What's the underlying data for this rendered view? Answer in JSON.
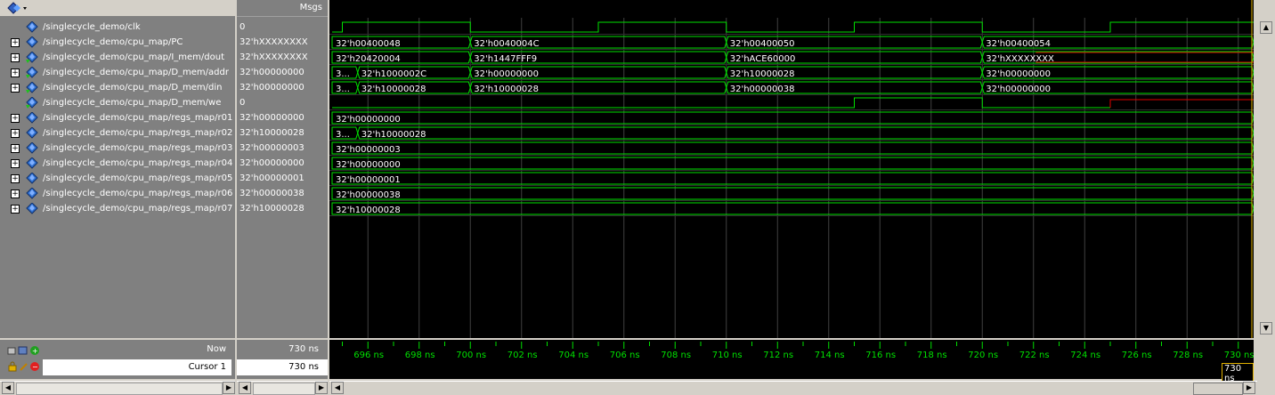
{
  "header": {
    "msgs_label": "Msgs"
  },
  "signals": [
    {
      "name": "/singlecycle_demo/clk",
      "value": "0",
      "expandable": false,
      "icon": "diamond-signal-icon"
    },
    {
      "name": "/singlecycle_demo/cpu_map/PC",
      "value": "32'hXXXXXXXX",
      "expandable": true,
      "icon": "diamond-signal-icon"
    },
    {
      "name": "/singlecycle_demo/cpu_map/I_mem/dout",
      "value": "32'hXXXXXXXX",
      "expandable": true,
      "icon": "diamond-arrow-signal-icon"
    },
    {
      "name": "/singlecycle_demo/cpu_map/D_mem/addr",
      "value": "32'h00000000",
      "expandable": true,
      "icon": "diamond-arrow-signal-icon"
    },
    {
      "name": "/singlecycle_demo/cpu_map/D_mem/din",
      "value": "32'h00000000",
      "expandable": true,
      "icon": "diamond-arrow-signal-icon"
    },
    {
      "name": "/singlecycle_demo/cpu_map/D_mem/we",
      "value": "0",
      "expandable": false,
      "icon": "diamond-arrow-signal-icon"
    },
    {
      "name": "/singlecycle_demo/cpu_map/regs_map/r01",
      "value": "32'h00000000",
      "expandable": true,
      "icon": "diamond-signal-icon"
    },
    {
      "name": "/singlecycle_demo/cpu_map/regs_map/r02",
      "value": "32'h10000028",
      "expandable": true,
      "icon": "diamond-signal-icon"
    },
    {
      "name": "/singlecycle_demo/cpu_map/regs_map/r03",
      "value": "32'h00000003",
      "expandable": true,
      "icon": "diamond-signal-icon"
    },
    {
      "name": "/singlecycle_demo/cpu_map/regs_map/r04",
      "value": "32'h00000000",
      "expandable": true,
      "icon": "diamond-signal-icon"
    },
    {
      "name": "/singlecycle_demo/cpu_map/regs_map/r05",
      "value": "32'h00000001",
      "expandable": true,
      "icon": "diamond-signal-icon"
    },
    {
      "name": "/singlecycle_demo/cpu_map/regs_map/r06",
      "value": "32'h00000038",
      "expandable": true,
      "icon": "diamond-signal-icon"
    },
    {
      "name": "/singlecycle_demo/cpu_map/regs_map/r07",
      "value": "32'h10000028",
      "expandable": true,
      "icon": "diamond-signal-icon"
    }
  ],
  "waves": {
    "time_start_ns": 694.6,
    "time_end_ns": 730.6,
    "clk_edges_ns": [
      [
        694.6,
        0
      ],
      [
        695.0,
        1
      ],
      [
        700.0,
        0
      ],
      [
        705.0,
        1
      ],
      [
        710.0,
        0
      ],
      [
        715.0,
        1
      ],
      [
        720.0,
        0
      ],
      [
        725.0,
        1
      ],
      [
        730.6,
        1
      ]
    ],
    "we_edges_ns": [
      [
        694.6,
        0
      ],
      [
        715.0,
        1
      ],
      [
        720.0,
        0
      ]
    ],
    "we_unknown_from_ns": 725.0,
    "buses": [
      {
        "row": 1,
        "segments": [
          {
            "t": 694.6,
            "label": "32'h00400048"
          },
          {
            "t": 700.0,
            "label": "32'h0040004C"
          },
          {
            "t": 710.0,
            "label": "32'h00400050"
          },
          {
            "t": 720.0,
            "label": "32'h00400054"
          }
        ]
      },
      {
        "row": 2,
        "segments": [
          {
            "t": 694.6,
            "label": "32'h20420004"
          },
          {
            "t": 700.0,
            "label": "32'h1447FFF9"
          },
          {
            "t": 710.0,
            "label": "32'hACE60000"
          },
          {
            "t": 720.0,
            "label": "32'hXXXXXXXX",
            "unknown": true
          }
        ]
      },
      {
        "row": 3,
        "segments": [
          {
            "t": 694.6,
            "label": "3..."
          },
          {
            "t": 695.6,
            "label": "32'h1000002C"
          },
          {
            "t": 700.0,
            "label": "32'h00000000"
          },
          {
            "t": 710.0,
            "label": "32'h10000028"
          },
          {
            "t": 720.0,
            "label": "32'h00000000"
          }
        ]
      },
      {
        "row": 4,
        "segments": [
          {
            "t": 694.6,
            "label": "3..."
          },
          {
            "t": 695.6,
            "label": "32'h10000028"
          },
          {
            "t": 700.0,
            "label": "32'h10000028"
          },
          {
            "t": 710.0,
            "label": "32'h00000038"
          },
          {
            "t": 720.0,
            "label": "32'h00000000"
          }
        ]
      },
      {
        "row": 6,
        "segments": [
          {
            "t": 694.6,
            "label": "32'h00000000"
          }
        ]
      },
      {
        "row": 7,
        "segments": [
          {
            "t": 694.6,
            "label": "3..."
          },
          {
            "t": 695.6,
            "label": "32'h10000028"
          }
        ]
      },
      {
        "row": 8,
        "segments": [
          {
            "t": 694.6,
            "label": "32'h00000003"
          }
        ]
      },
      {
        "row": 9,
        "segments": [
          {
            "t": 694.6,
            "label": "32'h00000000"
          }
        ]
      },
      {
        "row": 10,
        "segments": [
          {
            "t": 694.6,
            "label": "32'h00000001"
          }
        ]
      },
      {
        "row": 11,
        "segments": [
          {
            "t": 694.6,
            "label": "32'h00000038"
          }
        ]
      },
      {
        "row": 12,
        "segments": [
          {
            "t": 694.6,
            "label": "32'h10000028"
          }
        ]
      }
    ],
    "colors": {
      "wave": "#00e000",
      "unknown": "#e00000",
      "grid": "#404040",
      "background": "#000000"
    }
  },
  "timeline": {
    "ticks": [
      {
        "t": 696,
        "label": "696 ns"
      },
      {
        "t": 698,
        "label": "698 ns"
      },
      {
        "t": 700,
        "label": "700 ns"
      },
      {
        "t": 702,
        "label": "702 ns"
      },
      {
        "t": 704,
        "label": "704 ns"
      },
      {
        "t": 706,
        "label": "706 ns"
      },
      {
        "t": 708,
        "label": "708 ns"
      },
      {
        "t": 710,
        "label": "710 ns"
      },
      {
        "t": 712,
        "label": "712 ns"
      },
      {
        "t": 714,
        "label": "714 ns"
      },
      {
        "t": 716,
        "label": "716 ns"
      },
      {
        "t": 718,
        "label": "718 ns"
      },
      {
        "t": 720,
        "label": "720 ns"
      },
      {
        "t": 722,
        "label": "722 ns"
      },
      {
        "t": 724,
        "label": "724 ns"
      },
      {
        "t": 726,
        "label": "726 ns"
      },
      {
        "t": 728,
        "label": "728 ns"
      },
      {
        "t": 730,
        "label": "730 ns"
      }
    ],
    "now_label": "Now",
    "now_value": "730 ns",
    "cursor_label": "Cursor 1",
    "cursor_value": "730 ns",
    "cursor_marker": "730 ns"
  }
}
